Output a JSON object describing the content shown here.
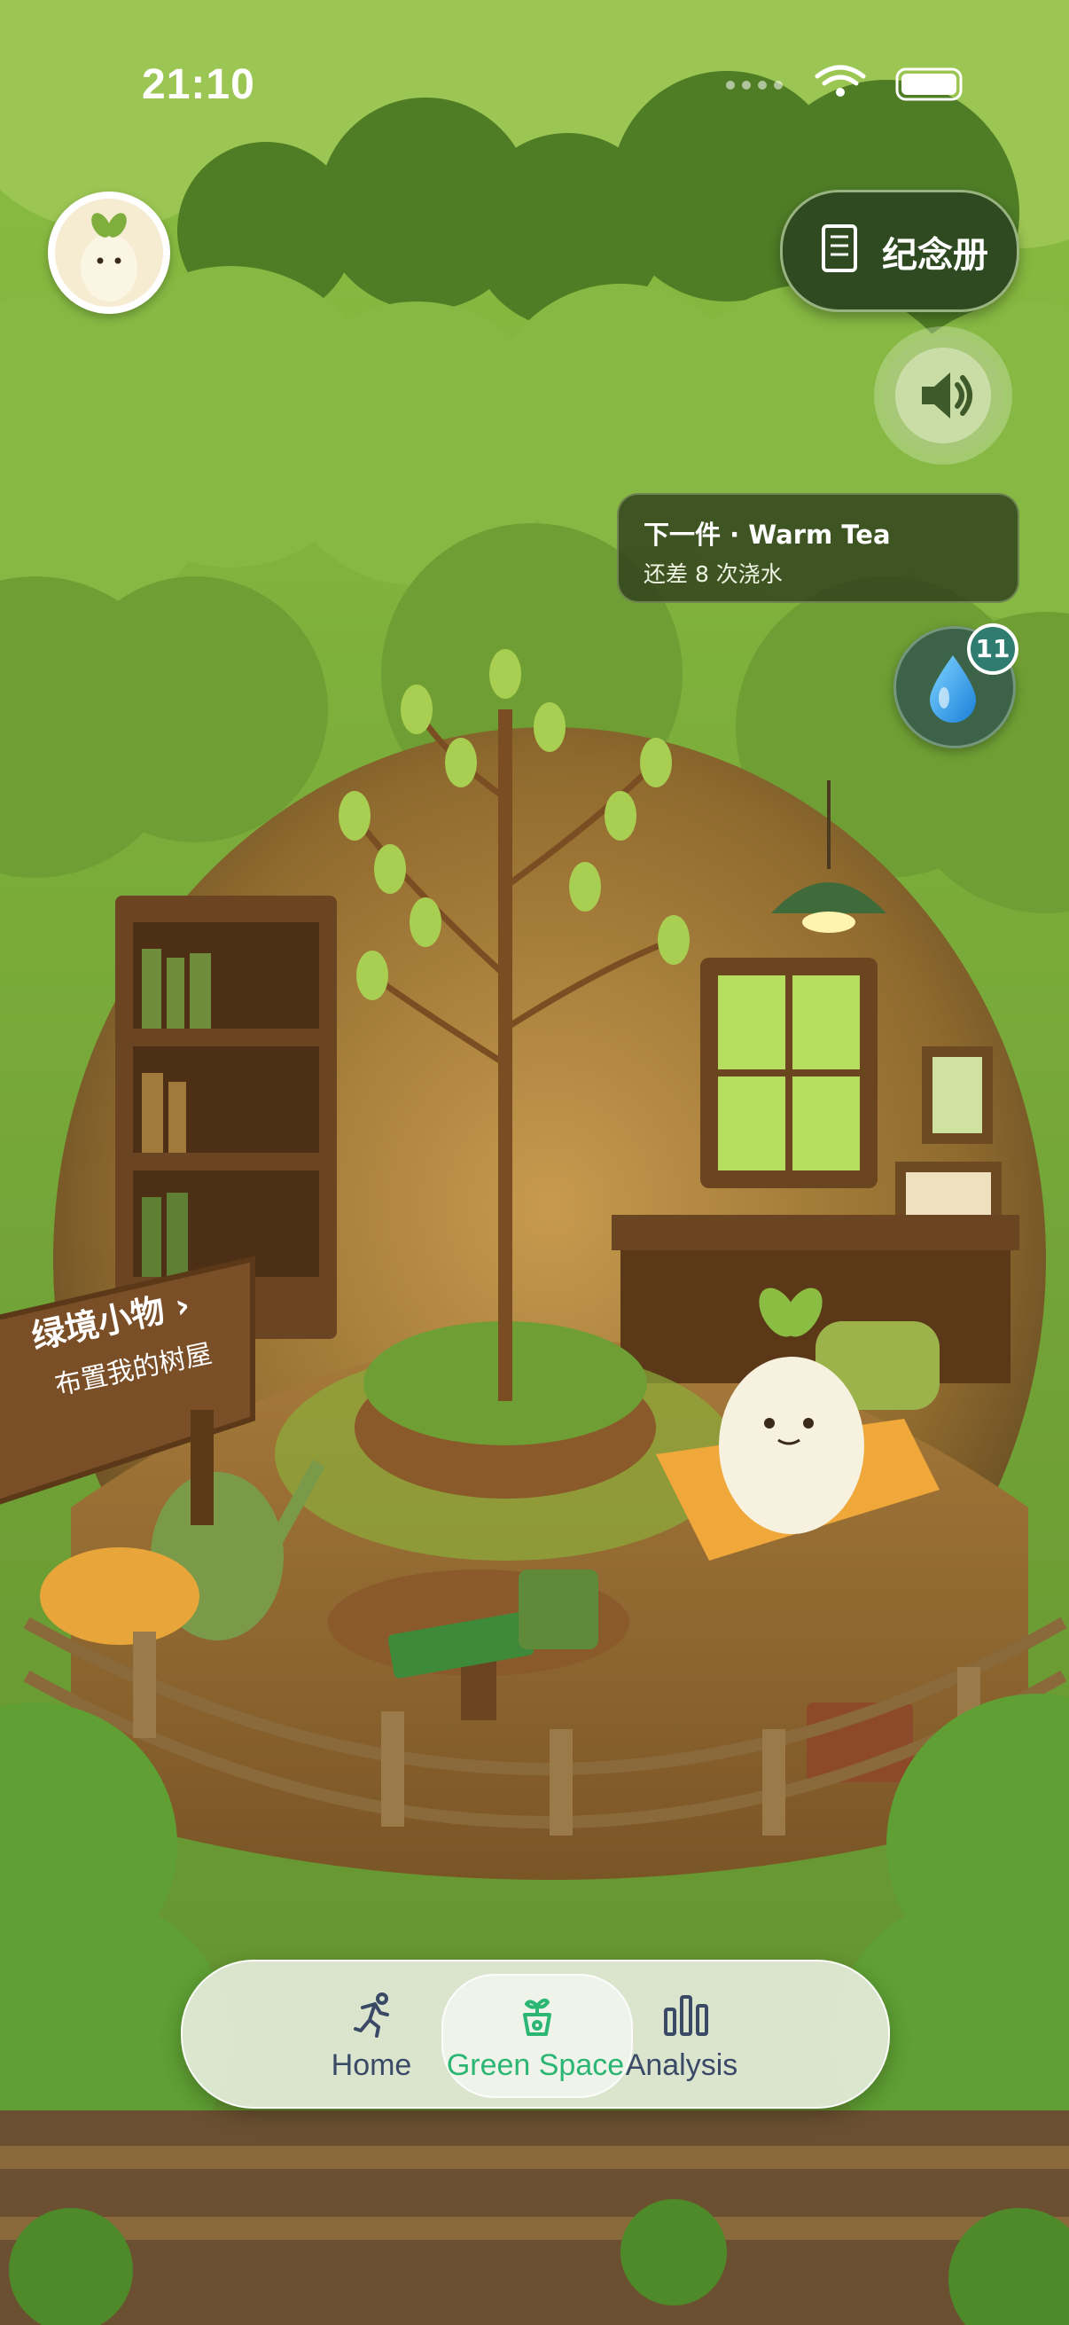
{
  "status_bar": {
    "time": "21:10"
  },
  "header": {
    "memo_label": "纪念册"
  },
  "next_item": {
    "title": "下一件 · Warm Tea",
    "subtitle": "还差 8 次浇水"
  },
  "water": {
    "count": "11"
  },
  "sign": {
    "title": "绿境小物 ›",
    "subtitle": "布置我的树屋"
  },
  "tabs": [
    {
      "label": "Home",
      "icon": "running-icon",
      "active": false
    },
    {
      "label": "Green Space",
      "icon": "sprout-pot-icon",
      "active": true
    },
    {
      "label": "Analysis",
      "icon": "bar-chart-icon",
      "active": false
    }
  ],
  "colors": {
    "active_tab": "#2bb673",
    "inactive_tab": "#3a4a66",
    "memo_bg": "#2f4a20",
    "foliage": "#7fae3c"
  }
}
